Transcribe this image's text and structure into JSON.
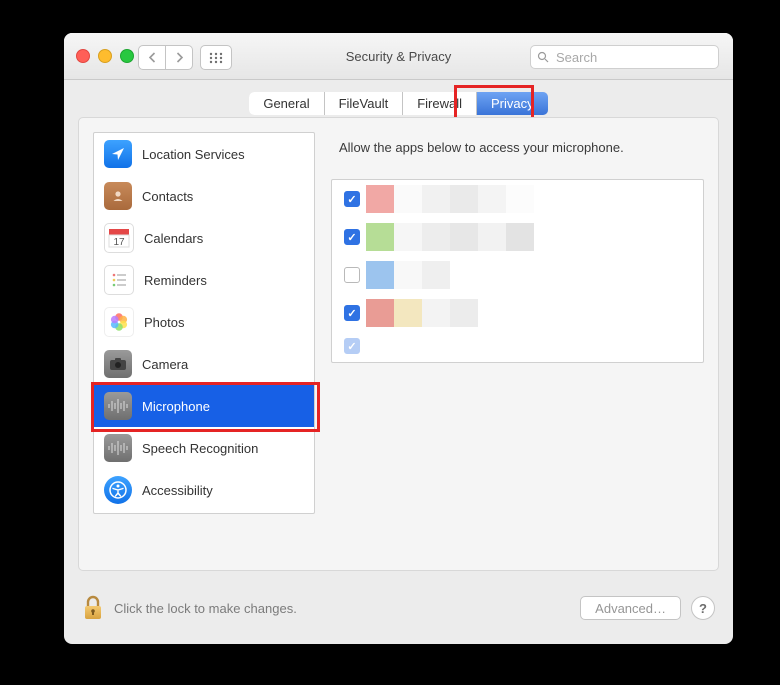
{
  "window": {
    "title": "Security & Privacy"
  },
  "search": {
    "placeholder": "Search",
    "value": ""
  },
  "tabs": [
    {
      "label": "General",
      "selected": false
    },
    {
      "label": "FileVault",
      "selected": false
    },
    {
      "label": "Firewall",
      "selected": false
    },
    {
      "label": "Privacy",
      "selected": true
    }
  ],
  "sidebar": {
    "items": [
      {
        "label": "Location Services",
        "icon": "location-icon"
      },
      {
        "label": "Contacts",
        "icon": "contacts-icon"
      },
      {
        "label": "Calendars",
        "icon": "calendar-icon"
      },
      {
        "label": "Reminders",
        "icon": "reminders-icon"
      },
      {
        "label": "Photos",
        "icon": "photos-icon"
      },
      {
        "label": "Camera",
        "icon": "camera-icon"
      },
      {
        "label": "Microphone",
        "icon": "microphone-icon",
        "selected": true
      },
      {
        "label": "Speech Recognition",
        "icon": "speech-icon"
      },
      {
        "label": "Accessibility",
        "icon": "accessibility-icon"
      }
    ]
  },
  "content": {
    "description": "Allow the apps below to access your microphone.",
    "apps": [
      {
        "checked": true,
        "redacted": true
      },
      {
        "checked": true,
        "redacted": true
      },
      {
        "checked": false,
        "redacted": true
      },
      {
        "checked": true,
        "redacted": true
      }
    ]
  },
  "footer": {
    "lock_text": "Click the lock to make changes.",
    "advanced_label": "Advanced…"
  },
  "highlights": [
    {
      "target": "tab-privacy"
    },
    {
      "target": "sidebar-item-microphone"
    }
  ],
  "colors": {
    "accent": "#1760e6",
    "highlight_border": "#e52424"
  }
}
